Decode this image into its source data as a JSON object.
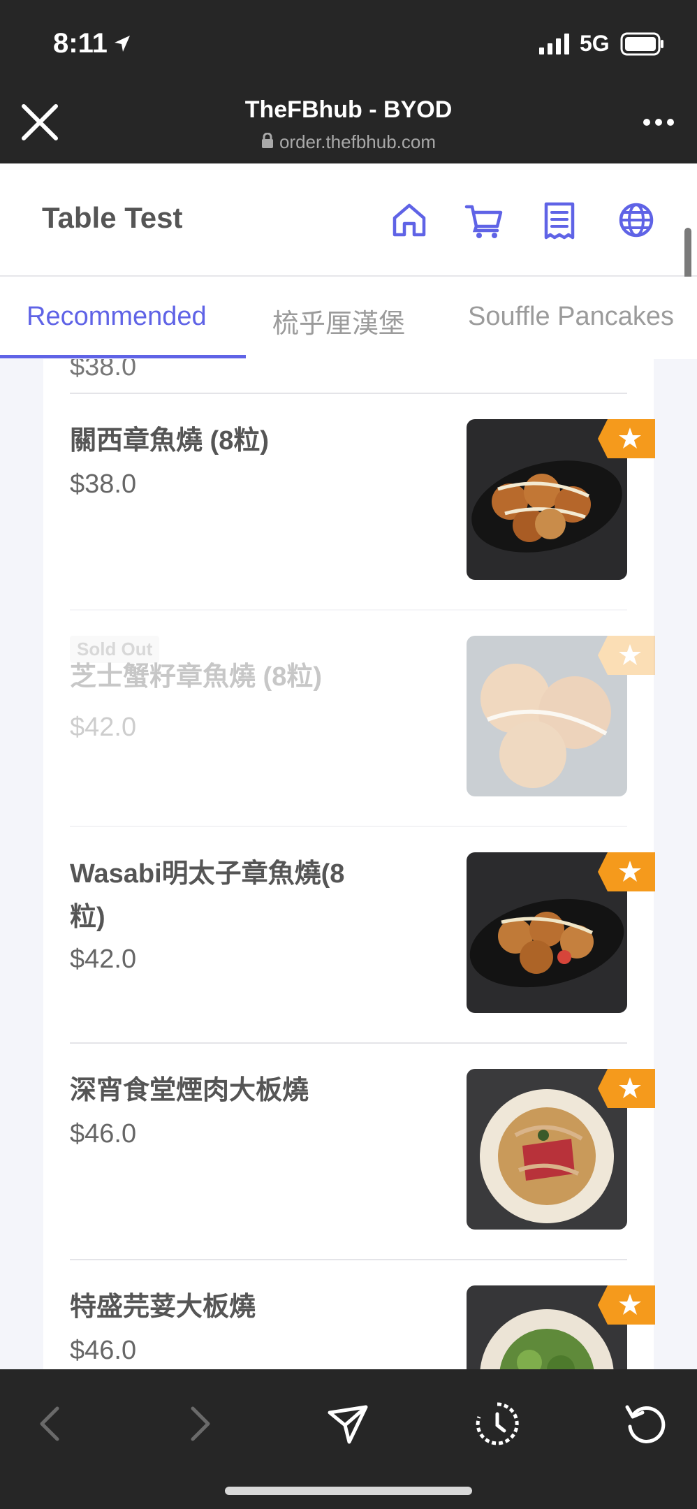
{
  "status": {
    "time": "8:11",
    "network": "5G"
  },
  "browser": {
    "title": "TheFBhub - BYOD",
    "url": "order.thefbhub.com"
  },
  "header": {
    "table_name": "Table Test"
  },
  "tabs": [
    "Recommended",
    "梳乎厘漢堡",
    "Souffle Pancakes"
  ],
  "menu": {
    "partial_price": "$38.0",
    "items": [
      {
        "name": "關西章魚燒 (8粒)",
        "price": "$38.0"
      },
      {
        "name": "芝士蟹籽章魚燒 (8粒)",
        "price": "$42.0",
        "tag": "Sold Out"
      },
      {
        "name": "Wasabi明太子章魚燒(8粒)",
        "price": "$42.0"
      },
      {
        "name": "深宵食堂煙肉大板燒",
        "price": "$46.0"
      },
      {
        "name": "特盛芫荽大板燒",
        "price": "$46.0"
      }
    ]
  },
  "colors": {
    "accent": "#5f63e6",
    "badge": "#f59a1c",
    "bar": "#262626"
  },
  "icons": [
    "home-icon",
    "cart-icon",
    "receipt-icon",
    "globe-icon",
    "star-icon"
  ]
}
